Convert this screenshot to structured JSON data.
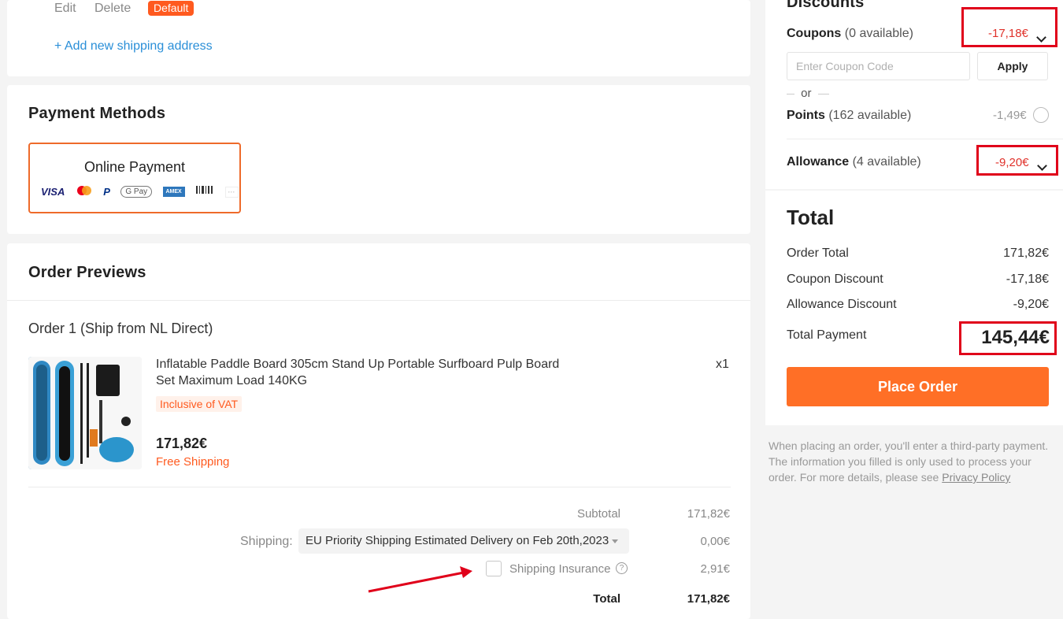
{
  "address": {
    "edit_label": "Edit",
    "delete_label": "Delete",
    "default_badge": "Default",
    "add_new_label": "+ Add new shipping address"
  },
  "payment_methods": {
    "title": "Payment Methods",
    "option_label": "Online Payment",
    "icons": [
      "VISA",
      "mastercard",
      "PayPal",
      "G Pay",
      "AMEX",
      "boleto",
      "more"
    ]
  },
  "order_previews": {
    "title": "Order Previews",
    "order_label": "Order 1 (Ship from NL Direct)",
    "item": {
      "title_line1": "Inflatable Paddle Board 305cm Stand Up Portable Surfboard Pulp Board",
      "title_line2": "Set Maximum Load 140KG",
      "vat_label": "Inclusive of VAT",
      "price": "171,82€",
      "shipping_label": "Free Shipping",
      "quantity": "x1"
    },
    "subtotal_label": "Subtotal",
    "subtotal_value": "171,82€",
    "shipping_label": "Shipping:",
    "shipping_option": "EU Priority Shipping Estimated Delivery on Feb 20th,2023",
    "shipping_value": "0,00€",
    "insurance_label": "Shipping Insurance",
    "insurance_value": "2,91€",
    "total_label": "Total",
    "total_value": "171,82€"
  },
  "discounts": {
    "title": "Discounts",
    "coupons_label": "Coupons",
    "coupons_available": "(0 available)",
    "coupons_value": "-17,18€",
    "coupon_placeholder": "Enter Coupon Code",
    "apply_label": "Apply",
    "or_label": "or",
    "points_label": "Points",
    "points_available": "(162 available)",
    "points_value": "-1,49€",
    "allowance_label": "Allowance",
    "allowance_available": "(4 available)",
    "allowance_value": "-9,20€"
  },
  "total": {
    "title": "Total",
    "order_total_label": "Order Total",
    "order_total_value": "171,82€",
    "coupon_discount_label": "Coupon Discount",
    "coupon_discount_value": "-17,18€",
    "allowance_discount_label": "Allowance Discount",
    "allowance_discount_value": "-9,20€",
    "total_payment_label": "Total Payment",
    "total_payment_value": "145,44€",
    "place_order_label": "Place Order"
  },
  "notice": {
    "text": "When placing an order, you'll enter a third-party payment. The information you filled is only used to process your order. For more details, please see",
    "privacy_link": "Privacy Policy"
  },
  "colors": {
    "accent": "#ff6f26",
    "discount_red": "#e0312a",
    "link_blue": "#2a8fd8",
    "highlight_box": "#e0001a"
  }
}
